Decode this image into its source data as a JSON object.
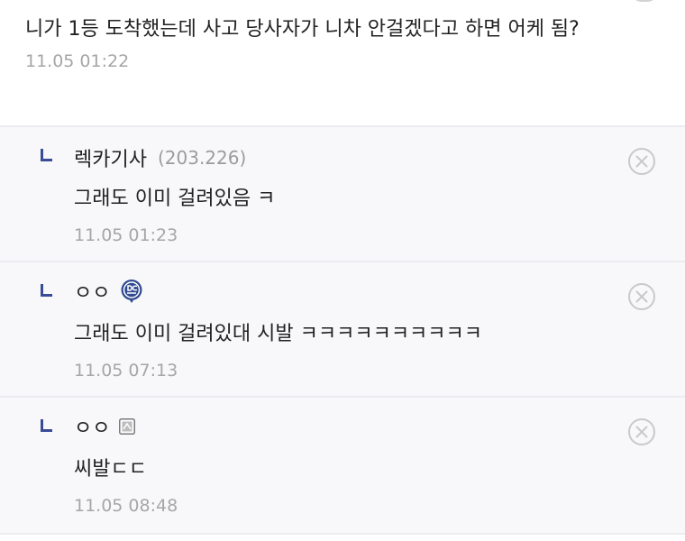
{
  "parent_comment": {
    "text": "니가 1등 도착했는데 사고 당사자가 니차 안걸겠다고 하면 어케 됨?",
    "time": "11.05 01:22"
  },
  "replies": [
    {
      "nickname": "렉카기사",
      "ip": "(203.226)",
      "text": "그래도 이미 걸려있음 ㅋ",
      "time": "11.05 01:23",
      "badge_icon": null
    },
    {
      "nickname": "ㅇㅇ",
      "ip": "",
      "text": "그래도 이미 걸려있대 시발 ㅋㅋㅋㅋㅋㅋㅋㅋㅋㅋ",
      "time": "11.05 07:13",
      "badge_icon": "gallog-dc-icon"
    },
    {
      "nickname": "ㅇㅇ",
      "ip": "",
      "text": "씨발ㄷㄷ",
      "time": "11.05 08:48",
      "badge_icon": "fixed-nick-icon"
    }
  ],
  "colors": {
    "reply_arrow": "#3a4c95",
    "timestamp": "#a6a6a6",
    "divider": "#ececf0",
    "reply_background": "#f8f8fa",
    "badge_blue": "#2f4a8f"
  }
}
